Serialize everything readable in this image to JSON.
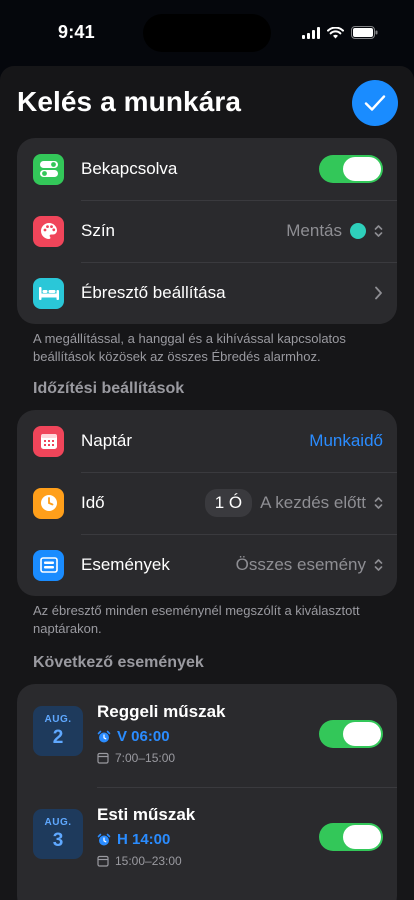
{
  "status": {
    "time": "9:41"
  },
  "header": {
    "title": "Kelés a munkára"
  },
  "settings": {
    "enabled_label": "Bekapcsolva",
    "color_label": "Szín",
    "color_value": "Mentás",
    "color_swatch": "#2ed0bb",
    "alarm_setup_label": "Ébresztő beállítása"
  },
  "settings_note": "A megállítással, a hanggal és a kihívással kapcsolatos beállítások közösek az összes Ébredés alarmhoz.",
  "timing": {
    "header": "Időzítési beállítások",
    "calendar_label": "Naptár",
    "calendar_value": "Munkaidő",
    "time_label": "Idő",
    "time_amount": "1 Ó",
    "time_value": "A kezdés előtt",
    "events_label": "Események",
    "events_value": "Összes esemény"
  },
  "timing_note": "Az ébresztő minden eseménynél megszólít a kiválasztott naptárakon.",
  "upcoming": {
    "header": "Következő események",
    "events": [
      {
        "month": "AUG.",
        "day": "2",
        "title": "Reggeli műszak",
        "alarm": "V 06:00",
        "range": "7:00–15:00",
        "enabled": true
      },
      {
        "month": "AUG.",
        "day": "3",
        "title": "Esti műszak",
        "alarm": "H 14:00",
        "range": "15:00–23:00",
        "enabled": true
      }
    ]
  },
  "colors": {
    "accent": "#1a8cff",
    "toggle_on": "#33c759"
  }
}
